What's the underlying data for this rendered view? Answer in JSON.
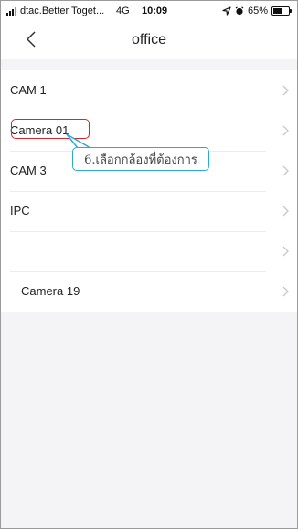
{
  "status_bar": {
    "carrier": "dtac.Better Toget...",
    "network": "4G",
    "time": "10:09",
    "battery_label": "65%",
    "battery_level": 0.65,
    "icons": [
      "signal-icon",
      "location-arrow-icon",
      "alarm-icon",
      "battery-icon"
    ]
  },
  "nav": {
    "title": "office",
    "back_icon": "chevron-left-icon"
  },
  "cameras": [
    {
      "label": "CAM 1"
    },
    {
      "label": "Camera 01"
    },
    {
      "label": "CAM 3"
    },
    {
      "label": "IPC"
    },
    {
      "label": ""
    },
    {
      "label": "Camera 19"
    }
  ],
  "annotation": {
    "text": "6.เลือกกล้องที่ต้องการ",
    "highlight_color": "#d8262c",
    "callout_color": "#2aa9d8"
  },
  "colors": {
    "background": "#f4f4f6",
    "row_background": "#ffffff",
    "chevron": "#c7c7cc"
  }
}
